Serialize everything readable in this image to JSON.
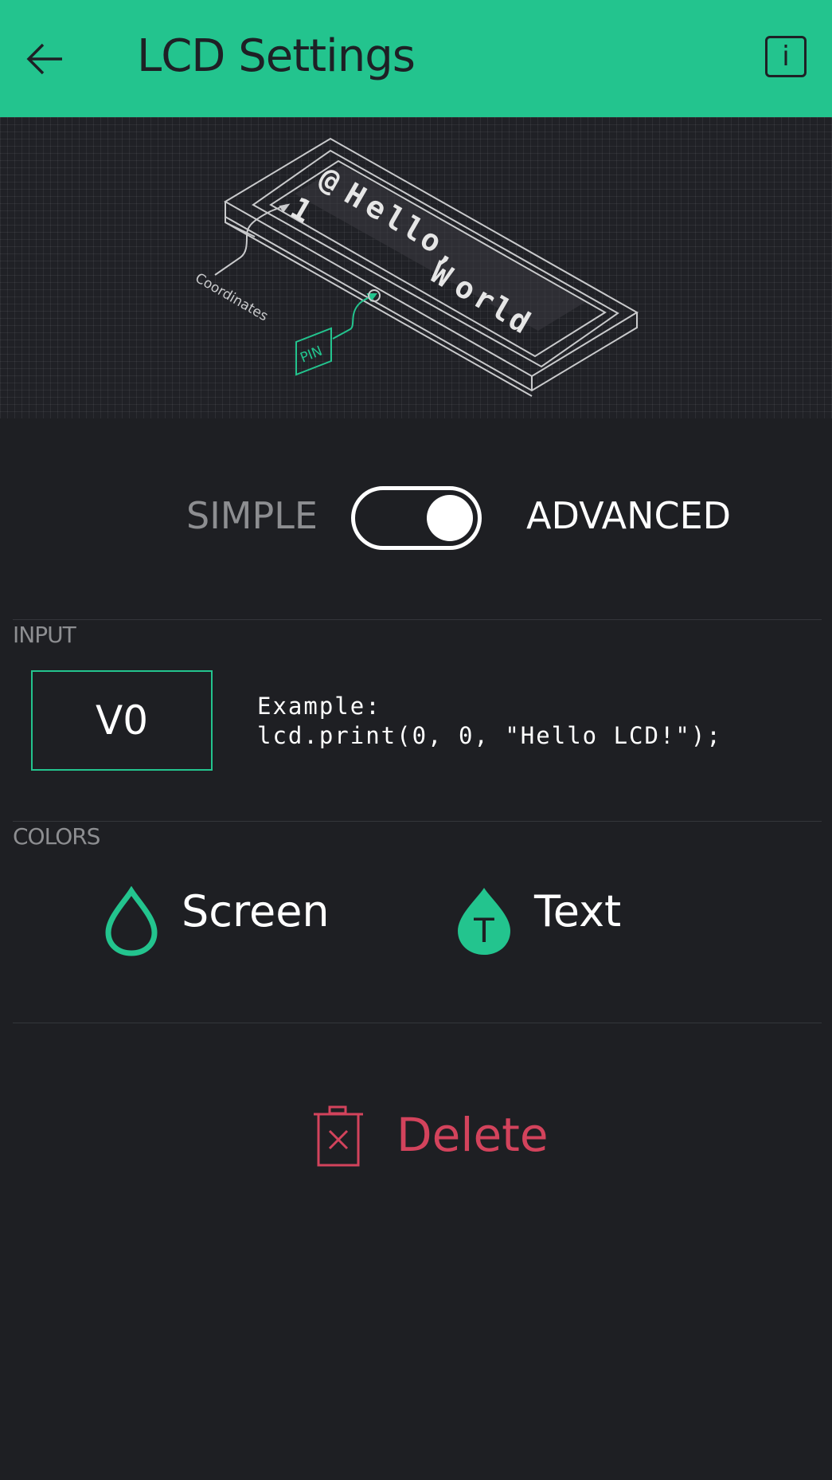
{
  "header": {
    "title": "LCD Settings",
    "back_icon": "arrow-left-icon",
    "info_label": "i",
    "background": "#23c48e"
  },
  "illustration": {
    "screen_chars": [
      "1",
      "@",
      "H",
      "e",
      "l",
      "l",
      "o",
      ",",
      "W",
      "o",
      "r",
      "l",
      "d"
    ],
    "callout_coordinates": "Coordinates",
    "callout_pin": "PIN"
  },
  "mode": {
    "simple_label": "SIMPLE",
    "advanced_label": "ADVANCED",
    "selected": "ADVANCED"
  },
  "input": {
    "section_label": "INPUT",
    "pin": "V0",
    "example_text": "Example:\nlcd.print(0, 0, \"Hello LCD!\");"
  },
  "colors": {
    "section_label": "COLORS",
    "screen_label": "Screen",
    "text_label": "Text",
    "text_icon_glyph": "T",
    "accent": "#23c48e"
  },
  "actions": {
    "delete_label": "Delete",
    "delete_color": "#d3435c"
  }
}
